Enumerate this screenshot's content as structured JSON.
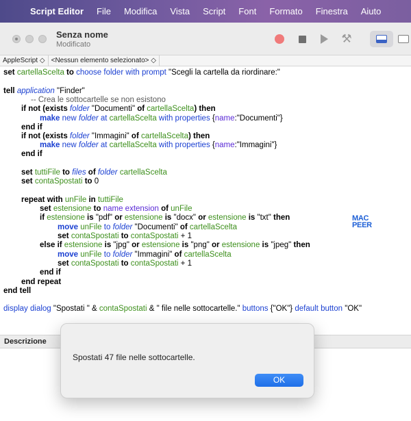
{
  "menubar": {
    "app": "Script Editor",
    "items": [
      "File",
      "Modifica",
      "Vista",
      "Script",
      "Font",
      "Formato",
      "Finestra",
      "Aiuto"
    ]
  },
  "window": {
    "title": "Senza nome",
    "subtitle": "Modificato"
  },
  "navbar": {
    "language": "AppleScript ◇",
    "selector": "<Nessun elemento selezionato> ◇"
  },
  "code": {
    "l1": {
      "a": "set",
      "b": " cartellaScelta",
      "c": " to",
      "d": " choose folder",
      "e": " with prompt",
      "f": " \"Scegli la cartella da riordinare:\""
    },
    "l2": {
      "a": "tell",
      "b": " application",
      "c": " \"Finder\""
    },
    "l3": {
      "a": "-- Crea le sottocartelle se non esistono"
    },
    "l4": {
      "a": "if not (",
      "b": "exists",
      "c": " folder",
      "d": " \"Documenti\"",
      "e": " of",
      "f": " cartellaScelta",
      "g": ") then"
    },
    "l5": {
      "a": "make",
      "b": " new",
      "c": " folder",
      "d": " at",
      "e": " cartellaScelta",
      "f": " with properties",
      "g": " {",
      "h": "name",
      "i": ":\"Documenti\"}"
    },
    "l6": {
      "a": "end if"
    },
    "l7": {
      "a": "if not (",
      "b": "exists",
      "c": " folder",
      "d": " \"Immagini\"",
      "e": " of",
      "f": " cartellaScelta",
      "g": ") then"
    },
    "l8": {
      "a": "make",
      "b": " new",
      "c": " folder",
      "d": " at",
      "e": " cartellaScelta",
      "f": " with properties",
      "g": " {",
      "h": "name",
      "i": ":\"Immagini\"}"
    },
    "l9": {
      "a": "end if"
    },
    "l10": {
      "a": "set",
      "b": " tuttiFile",
      "c": " to",
      "d": " files",
      "e": " of",
      "f": " folder",
      "g": " cartellaScelta"
    },
    "l11": {
      "a": "set",
      "b": " contaSpostati",
      "c": " to",
      "d": " 0"
    },
    "l12": {
      "a": "repeat with",
      "b": " unFile",
      "c": " in",
      "d": " tuttiFile"
    },
    "l13": {
      "a": "set",
      "b": " estensione",
      "c": " to",
      "d": " name extension",
      "e": " of",
      "f": " unFile"
    },
    "l14": {
      "a": "if",
      "b": " estensione",
      "c": " is",
      "d": " \"pdf\"",
      "e": " or",
      "f": " estensione",
      "g": " is",
      "h": " \"docx\"",
      "i": " or",
      "j": " estensione",
      "k": " is",
      "l": " \"txt\"",
      "m": " then"
    },
    "l15": {
      "a": "move",
      "b": " unFile",
      "c": " to",
      "d": " folder",
      "e": " \"Documenti\"",
      "f": " of",
      "g": " cartellaScelta"
    },
    "l16": {
      "a": "set",
      "b": " contaSpostati",
      "c": " to",
      "d": " contaSpostati",
      "e": " + 1"
    },
    "l17": {
      "a": "else if",
      "b": " estensione",
      "c": " is",
      "d": " \"jpg\"",
      "e": " or",
      "f": " estensione",
      "g": " is",
      "h": " \"png\"",
      "i": " or",
      "j": " estensione",
      "k": " is",
      "l": " \"jpeg\"",
      "m": " then"
    },
    "l18": {
      "a": "move",
      "b": " unFile",
      "c": " to",
      "d": " folder",
      "e": " \"Immagini\"",
      "f": " of",
      "g": " cartellaScelta"
    },
    "l19": {
      "a": "set",
      "b": " contaSpostati",
      "c": " to",
      "d": " contaSpostati",
      "e": " + 1"
    },
    "l20": {
      "a": "end if"
    },
    "l21": {
      "a": "end repeat"
    },
    "l22": {
      "a": "end tell"
    },
    "l23": {
      "a": "display dialog",
      "b": " \"Spostati \" & ",
      "c": "contaSpostati",
      "d": " & \" file nelle sottocartelle.\"",
      "e": " buttons",
      "f": " {\"OK\"}",
      "g": " default button",
      "h": " \"OK\""
    }
  },
  "watermark": {
    "line1": "MAC",
    "line2": "PEER"
  },
  "description": {
    "header": "Descrizione"
  },
  "dialog": {
    "message": "Spostati 47 file nelle sottocartelle.",
    "ok_label": "OK"
  },
  "colors": {
    "keyword": "#000000",
    "variable": "#3d8f1c",
    "class": "#1a3fd1",
    "command": "#1a3fd1",
    "accent": "#1f6fe8"
  }
}
